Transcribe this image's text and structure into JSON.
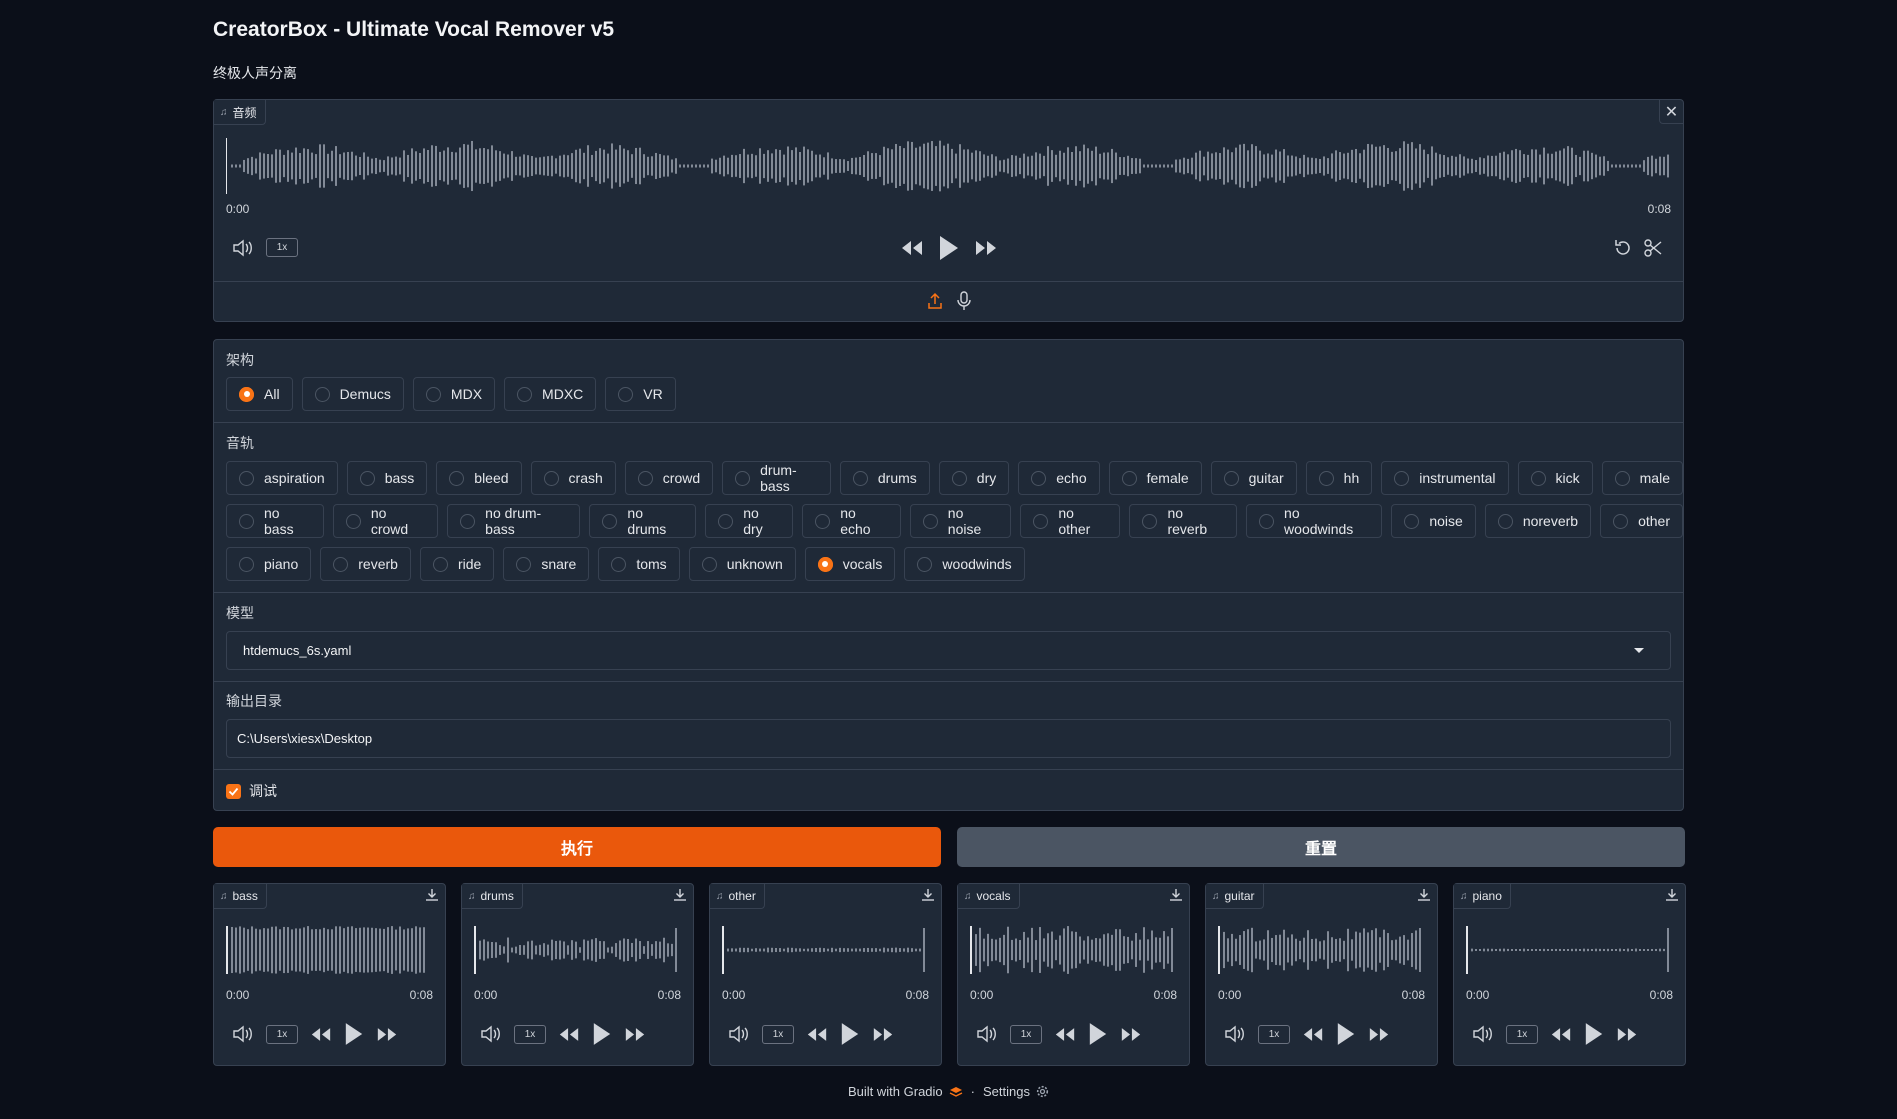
{
  "app": {
    "title": "CreatorBox - Ultimate Vocal Remover v5",
    "subtitle": "终极人声分离"
  },
  "audio_input": {
    "label": "音频",
    "time_start": "0:00",
    "time_end": "0:08",
    "rate": "1x"
  },
  "architecture": {
    "label": "架构",
    "options": [
      "All",
      "Demucs",
      "MDX",
      "MDXC",
      "VR"
    ],
    "selected": "All"
  },
  "tracks": {
    "label": "音轨",
    "rows": [
      [
        "aspiration",
        "bass",
        "bleed",
        "crash",
        "crowd",
        "drum-bass",
        "drums",
        "dry",
        "echo",
        "female",
        "guitar",
        "hh",
        "instrumental",
        "kick",
        "male"
      ],
      [
        "no bass",
        "no crowd",
        "no drum-bass",
        "no drums",
        "no dry",
        "no echo",
        "no noise",
        "no other",
        "no reverb",
        "no woodwinds",
        "noise",
        "noreverb",
        "other"
      ],
      [
        "piano",
        "reverb",
        "ride",
        "snare",
        "toms",
        "unknown",
        "vocals",
        "woodwinds"
      ]
    ],
    "selected": "vocals"
  },
  "model": {
    "label": "模型",
    "value": "htdemucs_6s.yaml"
  },
  "output_dir": {
    "label": "输出目录",
    "value": "C:\\Users\\xiesx\\Desktop"
  },
  "debug": {
    "label": "调试",
    "checked": true
  },
  "buttons": {
    "run": "执行",
    "reset": "重置"
  },
  "stems": [
    {
      "label": "bass",
      "time_start": "0:00",
      "time_end": "0:08",
      "rate": "1x"
    },
    {
      "label": "drums",
      "time_start": "0:00",
      "time_end": "0:08",
      "rate": "1x"
    },
    {
      "label": "other",
      "time_start": "0:00",
      "time_end": "0:08",
      "rate": "1x"
    },
    {
      "label": "vocals",
      "time_start": "0:00",
      "time_end": "0:08",
      "rate": "1x"
    },
    {
      "label": "guitar",
      "time_start": "0:00",
      "time_end": "0:08",
      "rate": "1x"
    },
    {
      "label": "piano",
      "time_start": "0:00",
      "time_end": "0:08",
      "rate": "1x"
    }
  ],
  "footer": {
    "built_with": "Built with Gradio",
    "separator": "·",
    "settings": "Settings"
  },
  "colors": {
    "accent": "#ea580c",
    "background": "#0b0f19",
    "panel": "#1f2937",
    "border": "#374151"
  }
}
